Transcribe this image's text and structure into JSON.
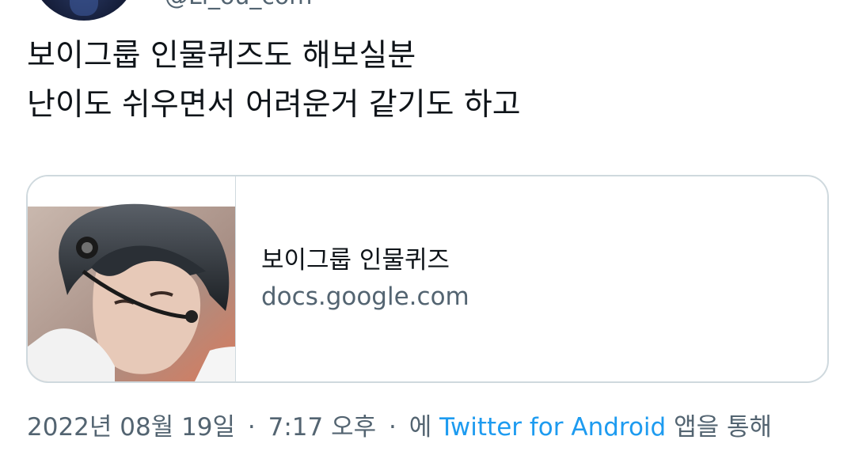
{
  "tweet": {
    "handle": "@Li_ou_com",
    "lines": [
      "보이그룹 인물퀴즈도 해보실분",
      "난이도 쉬우면서 어려운거 같기도 하고"
    ]
  },
  "card": {
    "title": "보이그룹 인물퀴즈",
    "domain": "docs.google.com",
    "thumb_icon": "person-photo"
  },
  "meta": {
    "date": "2022년 08월 19일",
    "separator": "·",
    "time": "7:17 오후",
    "prefix": "에",
    "source": "Twitter for Android",
    "suffix": "앱을 통해"
  },
  "colors": {
    "text": "#0f1419",
    "secondary": "#536471",
    "link": "#1d9bf0",
    "border": "#cfd9de"
  }
}
